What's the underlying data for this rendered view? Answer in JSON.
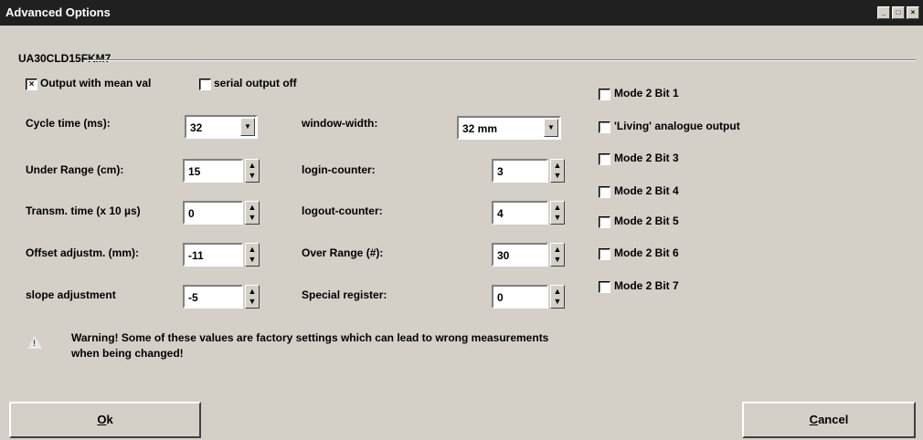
{
  "window": {
    "title": "Advanced Options",
    "controls": [
      "_",
      "□",
      "×"
    ]
  },
  "device": "UA30CLD15FKM7",
  "options": {
    "mean_value": {
      "label": "Output with mean val",
      "checked": true
    },
    "serial_off": {
      "label": "serial output off",
      "checked": false
    }
  },
  "left": {
    "cycle_time": {
      "label": "Cycle time (ms):",
      "value": "32"
    },
    "under_range": {
      "label": "Under Range (cm):",
      "value": "15"
    },
    "transm_time": {
      "label": "Transm. time (x 10 µs)",
      "value": "0"
    },
    "offset": {
      "label": "Offset adjustm. (mm):",
      "value": "-11"
    },
    "slope": {
      "label": "slope adjustment",
      "value": "-5"
    }
  },
  "middle": {
    "window_width": {
      "label": "window-width:",
      "value": "32 mm"
    },
    "login_counter": {
      "label": "login-counter:",
      "value": "3"
    },
    "logout_counter": {
      "label": "logout-counter:",
      "value": "4"
    },
    "over_range": {
      "label": "Over Range (#):",
      "value": "30"
    },
    "special_register": {
      "label": "Special register:",
      "value": "0"
    }
  },
  "right": [
    {
      "label": "Mode 2 Bit 1",
      "checked": false
    },
    {
      "label": "'Living' analogue output",
      "checked": false
    },
    {
      "label": "Mode 2 Bit 3",
      "checked": false
    },
    {
      "label": "Mode 2 Bit 4",
      "checked": false
    },
    {
      "label": "Mode 2 Bit 5",
      "checked": false
    },
    {
      "label": "Mode 2 Bit 6",
      "checked": false
    },
    {
      "label": "Mode 2 Bit 7",
      "checked": false
    }
  ],
  "warning": {
    "line1": "Warning! Some of these values are factory settings which can lead to wrong measurements",
    "line2": "when being changed!"
  },
  "buttons": {
    "ok_underline": "O",
    "ok_rest": "k",
    "cancel_underline": "C",
    "cancel_rest": "ancel"
  }
}
